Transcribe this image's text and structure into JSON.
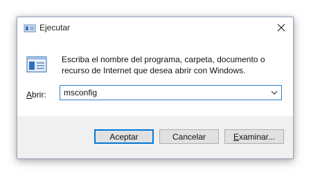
{
  "window": {
    "title": "Ejecutar",
    "close_symbol": "✕"
  },
  "icons": {
    "title_icon": "run-icon",
    "big_icon": "run-icon",
    "close_icon": "close-icon",
    "dropdown_icon": "chevron-down-icon"
  },
  "dialog": {
    "description": "Escriba el nombre del programa, carpeta, documento o recurso de Internet que desea abrir con Windows.",
    "open_label_accel": "A",
    "open_label_rest": "brir:",
    "input_value": "msconfig"
  },
  "buttons": {
    "accept": "Aceptar",
    "cancel": "Cancelar",
    "browse_accel": "E",
    "browse_rest": "xaminar..."
  },
  "colors": {
    "accent": "#0078d7",
    "footer": "#f0f0f0",
    "button_face": "#e1e1e1"
  }
}
